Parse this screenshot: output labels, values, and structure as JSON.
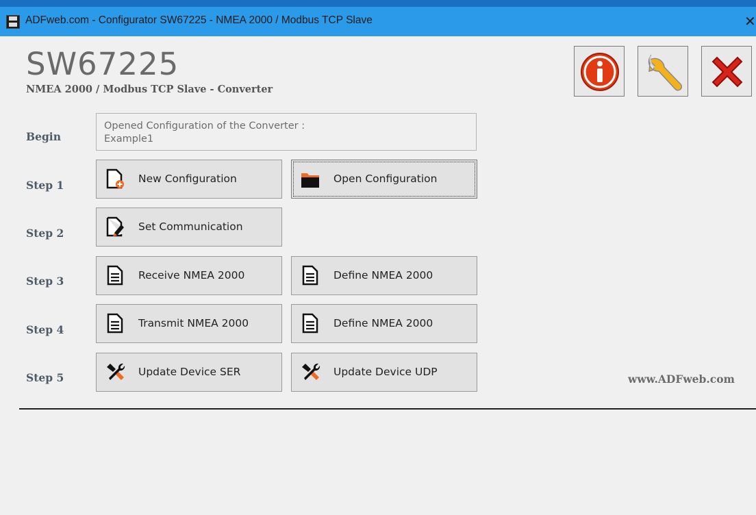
{
  "window": {
    "title": "ADFweb.com - Configurator SW67225 - NMEA 2000 / Modbus TCP Slave",
    "close_glyph": "✕",
    "app_icon": "adfweb-logo-icon"
  },
  "header": {
    "product_code": "SW67225",
    "subtitle": "NMEA 2000 / Modbus TCP Slave - Converter",
    "buttons": [
      {
        "name": "info-button",
        "icon": "info-icon",
        "color": "#e23b14"
      },
      {
        "name": "settings-button",
        "icon": "wrench-icon",
        "color": "#f3b21d"
      },
      {
        "name": "exit-button",
        "icon": "red-x-icon",
        "color": "#d7241b"
      }
    ]
  },
  "begin": {
    "label": "Begin",
    "opened_caption": "Opened Configuration of the Converter :",
    "opened_name": "Example1"
  },
  "steps": [
    {
      "label": "Step 1",
      "buttons": [
        {
          "label": "New Configuration",
          "icon": "new-document-icon"
        },
        {
          "label": "Open Configuration",
          "icon": "folder-icon",
          "focused": true
        }
      ]
    },
    {
      "label": "Step 2",
      "buttons": [
        {
          "label": "Set Communication",
          "icon": "edit-document-icon"
        }
      ]
    },
    {
      "label": "Step 3",
      "buttons": [
        {
          "label": "Receive NMEA 2000",
          "icon": "document-icon"
        },
        {
          "label": "Define NMEA 2000",
          "icon": "document-icon"
        }
      ]
    },
    {
      "label": "Step 4",
      "buttons": [
        {
          "label": "Transmit NMEA 2000",
          "icon": "document-icon"
        },
        {
          "label": "Define NMEA 2000",
          "icon": "document-icon"
        }
      ]
    },
    {
      "label": "Step 5",
      "buttons": [
        {
          "label": "Update Device SER",
          "icon": "tools-icon"
        },
        {
          "label": "Update Device UDP",
          "icon": "tools-icon"
        }
      ]
    }
  ],
  "footer": {
    "website": "www.ADFweb.com"
  },
  "colors": {
    "titlebar": "#2b9ae8",
    "accent_orange": "#f26a21",
    "client_bg": "#f0f0f0"
  }
}
